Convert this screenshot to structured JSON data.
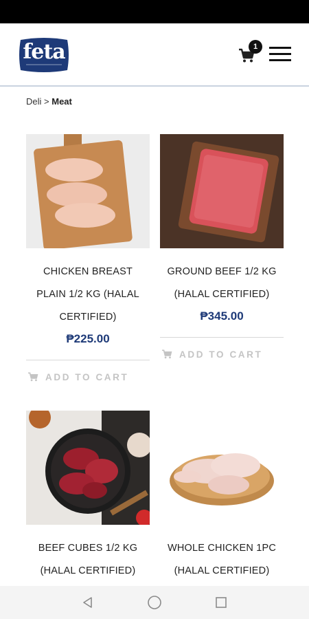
{
  "header": {
    "logo_text": "feta",
    "logo_tagline": "MEDITERRANEAN",
    "cart_count": "1",
    "brand_color": "#1e3a78"
  },
  "breadcrumb": {
    "parent": "Deli",
    "separator": ">",
    "current": "Meat"
  },
  "products": [
    {
      "name_line1": "CHICKEN BREAST",
      "name_line2": "PLAIN 1/2 KG (HALAL",
      "name_line3": "CERTIFIED)",
      "price": "₱225.00",
      "cta": "ADD TO CART",
      "image": "chicken-breast-image"
    },
    {
      "name_line1": "GROUND BEEF 1/2 KG",
      "name_line2": "(HALAL CERTIFIED)",
      "price": "₱345.00",
      "cta": "ADD TO CART",
      "image": "ground-beef-image"
    },
    {
      "name_line1": "BEEF CUBES 1/2 KG",
      "name_line2": "(HALAL CERTIFIED)",
      "image": "beef-cubes-image"
    },
    {
      "name_line1": "WHOLE CHICKEN 1PC",
      "name_line2": "(HALAL CERTIFIED)",
      "image": "whole-chicken-image"
    }
  ],
  "icons": {
    "cart": "cart-icon",
    "menu": "hamburger-menu-icon",
    "nav": [
      "back-triangle-icon",
      "home-circle-icon",
      "recents-square-icon"
    ]
  }
}
